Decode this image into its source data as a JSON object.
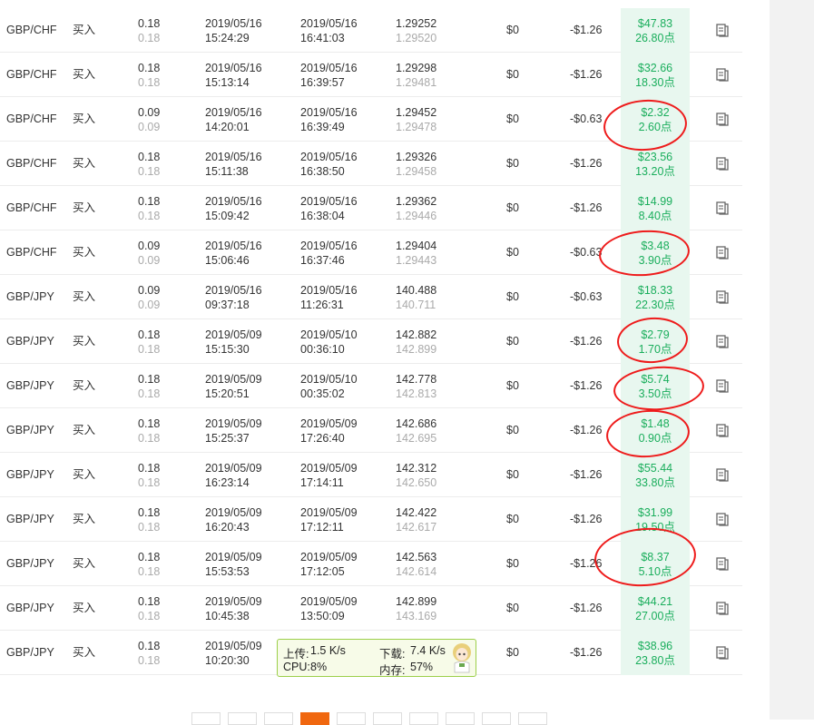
{
  "rows": [
    {
      "symbol": "GBP/CHF",
      "direction": "买入",
      "lot": "0.18",
      "lot_closed": "0.18",
      "open_date": "2019/05/16",
      "open_time": "15:24:29",
      "close_date": "2019/05/16",
      "close_time": "16:41:03",
      "open_price": "1.29252",
      "close_price": "1.29520",
      "commission": "$0",
      "swap": "-$1.26",
      "profit": "$47.83",
      "points": "26.80点"
    },
    {
      "symbol": "GBP/CHF",
      "direction": "买入",
      "lot": "0.18",
      "lot_closed": "0.18",
      "open_date": "2019/05/16",
      "open_time": "15:13:14",
      "close_date": "2019/05/16",
      "close_time": "16:39:57",
      "open_price": "1.29298",
      "close_price": "1.29481",
      "commission": "$0",
      "swap": "-$1.26",
      "profit": "$32.66",
      "points": "18.30点"
    },
    {
      "symbol": "GBP/CHF",
      "direction": "买入",
      "lot": "0.09",
      "lot_closed": "0.09",
      "open_date": "2019/05/16",
      "open_time": "14:20:01",
      "close_date": "2019/05/16",
      "close_time": "16:39:49",
      "open_price": "1.29452",
      "close_price": "1.29478",
      "commission": "$0",
      "swap": "-$0.63",
      "profit": "$2.32",
      "points": "2.60点"
    },
    {
      "symbol": "GBP/CHF",
      "direction": "买入",
      "lot": "0.18",
      "lot_closed": "0.18",
      "open_date": "2019/05/16",
      "open_time": "15:11:38",
      "close_date": "2019/05/16",
      "close_time": "16:38:50",
      "open_price": "1.29326",
      "close_price": "1.29458",
      "commission": "$0",
      "swap": "-$1.26",
      "profit": "$23.56",
      "points": "13.20点"
    },
    {
      "symbol": "GBP/CHF",
      "direction": "买入",
      "lot": "0.18",
      "lot_closed": "0.18",
      "open_date": "2019/05/16",
      "open_time": "15:09:42",
      "close_date": "2019/05/16",
      "close_time": "16:38:04",
      "open_price": "1.29362",
      "close_price": "1.29446",
      "commission": "$0",
      "swap": "-$1.26",
      "profit": "$14.99",
      "points": "8.40点"
    },
    {
      "symbol": "GBP/CHF",
      "direction": "买入",
      "lot": "0.09",
      "lot_closed": "0.09",
      "open_date": "2019/05/16",
      "open_time": "15:06:46",
      "close_date": "2019/05/16",
      "close_time": "16:37:46",
      "open_price": "1.29404",
      "close_price": "1.29443",
      "commission": "$0",
      "swap": "-$0.63",
      "profit": "$3.48",
      "points": "3.90点"
    },
    {
      "symbol": "GBP/JPY",
      "direction": "买入",
      "lot": "0.09",
      "lot_closed": "0.09",
      "open_date": "2019/05/16",
      "open_time": "09:37:18",
      "close_date": "2019/05/16",
      "close_time": "11:26:31",
      "open_price": "140.488",
      "close_price": "140.711",
      "commission": "$0",
      "swap": "-$0.63",
      "profit": "$18.33",
      "points": "22.30点"
    },
    {
      "symbol": "GBP/JPY",
      "direction": "买入",
      "lot": "0.18",
      "lot_closed": "0.18",
      "open_date": "2019/05/09",
      "open_time": "15:15:30",
      "close_date": "2019/05/10",
      "close_time": "00:36:10",
      "open_price": "142.882",
      "close_price": "142.899",
      "commission": "$0",
      "swap": "-$1.26",
      "profit": "$2.79",
      "points": "1.70点"
    },
    {
      "symbol": "GBP/JPY",
      "direction": "买入",
      "lot": "0.18",
      "lot_closed": "0.18",
      "open_date": "2019/05/09",
      "open_time": "15:20:51",
      "close_date": "2019/05/10",
      "close_time": "00:35:02",
      "open_price": "142.778",
      "close_price": "142.813",
      "commission": "$0",
      "swap": "-$1.26",
      "profit": "$5.74",
      "points": "3.50点"
    },
    {
      "symbol": "GBP/JPY",
      "direction": "买入",
      "lot": "0.18",
      "lot_closed": "0.18",
      "open_date": "2019/05/09",
      "open_time": "15:25:37",
      "close_date": "2019/05/09",
      "close_time": "17:26:40",
      "open_price": "142.686",
      "close_price": "142.695",
      "commission": "$0",
      "swap": "-$1.26",
      "profit": "$1.48",
      "points": "0.90点"
    },
    {
      "symbol": "GBP/JPY",
      "direction": "买入",
      "lot": "0.18",
      "lot_closed": "0.18",
      "open_date": "2019/05/09",
      "open_time": "16:23:14",
      "close_date": "2019/05/09",
      "close_time": "17:14:11",
      "open_price": "142.312",
      "close_price": "142.650",
      "commission": "$0",
      "swap": "-$1.26",
      "profit": "$55.44",
      "points": "33.80点"
    },
    {
      "symbol": "GBP/JPY",
      "direction": "买入",
      "lot": "0.18",
      "lot_closed": "0.18",
      "open_date": "2019/05/09",
      "open_time": "16:20:43",
      "close_date": "2019/05/09",
      "close_time": "17:12:11",
      "open_price": "142.422",
      "close_price": "142.617",
      "commission": "$0",
      "swap": "-$1.26",
      "profit": "$31.99",
      "points": "19.50点"
    },
    {
      "symbol": "GBP/JPY",
      "direction": "买入",
      "lot": "0.18",
      "lot_closed": "0.18",
      "open_date": "2019/05/09",
      "open_time": "15:53:53",
      "close_date": "2019/05/09",
      "close_time": "17:12:05",
      "open_price": "142.563",
      "close_price": "142.614",
      "commission": "$0",
      "swap": "-$1.26",
      "profit": "$8.37",
      "points": "5.10点"
    },
    {
      "symbol": "GBP/JPY",
      "direction": "买入",
      "lot": "0.18",
      "lot_closed": "0.18",
      "open_date": "2019/05/09",
      "open_time": "10:45:38",
      "close_date": "2019/05/09",
      "close_time": "13:50:09",
      "open_price": "142.899",
      "close_price": "143.169",
      "commission": "$0",
      "swap": "-$1.26",
      "profit": "$44.21",
      "points": "27.00点"
    },
    {
      "symbol": "GBP/JPY",
      "direction": "买入",
      "lot": "0.18",
      "lot_closed": "0.18",
      "open_date": "2019/05/09",
      "open_time": "10:20:30",
      "close_date": "",
      "close_time": "",
      "open_price": "",
      "close_price": "",
      "commission": "$0",
      "swap": "-$1.26",
      "profit": "$38.96",
      "points": "23.80点"
    }
  ],
  "net_widget": {
    "upload_label": "上传:",
    "upload_value": "1.5 K/s",
    "download_label": "下载:",
    "download_value": "7.4 K/s",
    "cpu_label": "CPU:",
    "cpu_value": "8%",
    "mem_label": "内存:",
    "mem_value": "57%"
  },
  "colors": {
    "profit": "#1aae5c",
    "profit_bg": "#e8f7ef",
    "annotation": "#ee1b1b",
    "pager_active": "#f0670f",
    "widget_border": "#9ccf4a"
  }
}
